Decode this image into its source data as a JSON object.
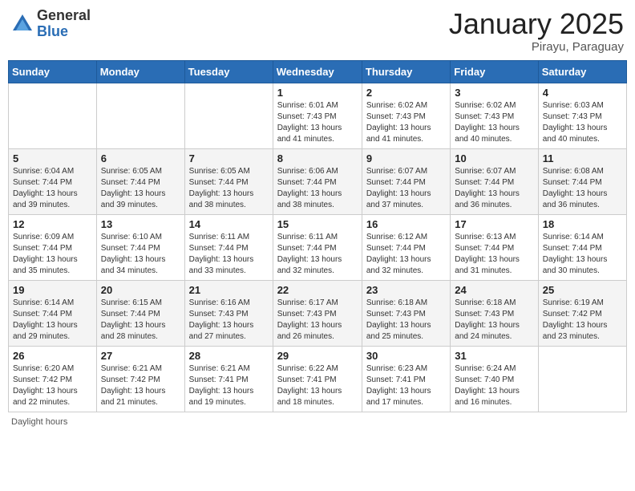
{
  "header": {
    "logo_general": "General",
    "logo_blue": "Blue",
    "month_title": "January 2025",
    "location": "Pirayu, Paraguay"
  },
  "days_of_week": [
    "Sunday",
    "Monday",
    "Tuesday",
    "Wednesday",
    "Thursday",
    "Friday",
    "Saturday"
  ],
  "weeks": [
    [
      {
        "day": "",
        "info": ""
      },
      {
        "day": "",
        "info": ""
      },
      {
        "day": "",
        "info": ""
      },
      {
        "day": "1",
        "info": "Sunrise: 6:01 AM\nSunset: 7:43 PM\nDaylight: 13 hours\nand 41 minutes."
      },
      {
        "day": "2",
        "info": "Sunrise: 6:02 AM\nSunset: 7:43 PM\nDaylight: 13 hours\nand 41 minutes."
      },
      {
        "day": "3",
        "info": "Sunrise: 6:02 AM\nSunset: 7:43 PM\nDaylight: 13 hours\nand 40 minutes."
      },
      {
        "day": "4",
        "info": "Sunrise: 6:03 AM\nSunset: 7:43 PM\nDaylight: 13 hours\nand 40 minutes."
      }
    ],
    [
      {
        "day": "5",
        "info": "Sunrise: 6:04 AM\nSunset: 7:44 PM\nDaylight: 13 hours\nand 39 minutes."
      },
      {
        "day": "6",
        "info": "Sunrise: 6:05 AM\nSunset: 7:44 PM\nDaylight: 13 hours\nand 39 minutes."
      },
      {
        "day": "7",
        "info": "Sunrise: 6:05 AM\nSunset: 7:44 PM\nDaylight: 13 hours\nand 38 minutes."
      },
      {
        "day": "8",
        "info": "Sunrise: 6:06 AM\nSunset: 7:44 PM\nDaylight: 13 hours\nand 38 minutes."
      },
      {
        "day": "9",
        "info": "Sunrise: 6:07 AM\nSunset: 7:44 PM\nDaylight: 13 hours\nand 37 minutes."
      },
      {
        "day": "10",
        "info": "Sunrise: 6:07 AM\nSunset: 7:44 PM\nDaylight: 13 hours\nand 36 minutes."
      },
      {
        "day": "11",
        "info": "Sunrise: 6:08 AM\nSunset: 7:44 PM\nDaylight: 13 hours\nand 36 minutes."
      }
    ],
    [
      {
        "day": "12",
        "info": "Sunrise: 6:09 AM\nSunset: 7:44 PM\nDaylight: 13 hours\nand 35 minutes."
      },
      {
        "day": "13",
        "info": "Sunrise: 6:10 AM\nSunset: 7:44 PM\nDaylight: 13 hours\nand 34 minutes."
      },
      {
        "day": "14",
        "info": "Sunrise: 6:11 AM\nSunset: 7:44 PM\nDaylight: 13 hours\nand 33 minutes."
      },
      {
        "day": "15",
        "info": "Sunrise: 6:11 AM\nSunset: 7:44 PM\nDaylight: 13 hours\nand 32 minutes."
      },
      {
        "day": "16",
        "info": "Sunrise: 6:12 AM\nSunset: 7:44 PM\nDaylight: 13 hours\nand 32 minutes."
      },
      {
        "day": "17",
        "info": "Sunrise: 6:13 AM\nSunset: 7:44 PM\nDaylight: 13 hours\nand 31 minutes."
      },
      {
        "day": "18",
        "info": "Sunrise: 6:14 AM\nSunset: 7:44 PM\nDaylight: 13 hours\nand 30 minutes."
      }
    ],
    [
      {
        "day": "19",
        "info": "Sunrise: 6:14 AM\nSunset: 7:44 PM\nDaylight: 13 hours\nand 29 minutes."
      },
      {
        "day": "20",
        "info": "Sunrise: 6:15 AM\nSunset: 7:44 PM\nDaylight: 13 hours\nand 28 minutes."
      },
      {
        "day": "21",
        "info": "Sunrise: 6:16 AM\nSunset: 7:43 PM\nDaylight: 13 hours\nand 27 minutes."
      },
      {
        "day": "22",
        "info": "Sunrise: 6:17 AM\nSunset: 7:43 PM\nDaylight: 13 hours\nand 26 minutes."
      },
      {
        "day": "23",
        "info": "Sunrise: 6:18 AM\nSunset: 7:43 PM\nDaylight: 13 hours\nand 25 minutes."
      },
      {
        "day": "24",
        "info": "Sunrise: 6:18 AM\nSunset: 7:43 PM\nDaylight: 13 hours\nand 24 minutes."
      },
      {
        "day": "25",
        "info": "Sunrise: 6:19 AM\nSunset: 7:42 PM\nDaylight: 13 hours\nand 23 minutes."
      }
    ],
    [
      {
        "day": "26",
        "info": "Sunrise: 6:20 AM\nSunset: 7:42 PM\nDaylight: 13 hours\nand 22 minutes."
      },
      {
        "day": "27",
        "info": "Sunrise: 6:21 AM\nSunset: 7:42 PM\nDaylight: 13 hours\nand 21 minutes."
      },
      {
        "day": "28",
        "info": "Sunrise: 6:21 AM\nSunset: 7:41 PM\nDaylight: 13 hours\nand 19 minutes."
      },
      {
        "day": "29",
        "info": "Sunrise: 6:22 AM\nSunset: 7:41 PM\nDaylight: 13 hours\nand 18 minutes."
      },
      {
        "day": "30",
        "info": "Sunrise: 6:23 AM\nSunset: 7:41 PM\nDaylight: 13 hours\nand 17 minutes."
      },
      {
        "day": "31",
        "info": "Sunrise: 6:24 AM\nSunset: 7:40 PM\nDaylight: 13 hours\nand 16 minutes."
      },
      {
        "day": "",
        "info": ""
      }
    ]
  ],
  "footer_note": "Daylight hours"
}
